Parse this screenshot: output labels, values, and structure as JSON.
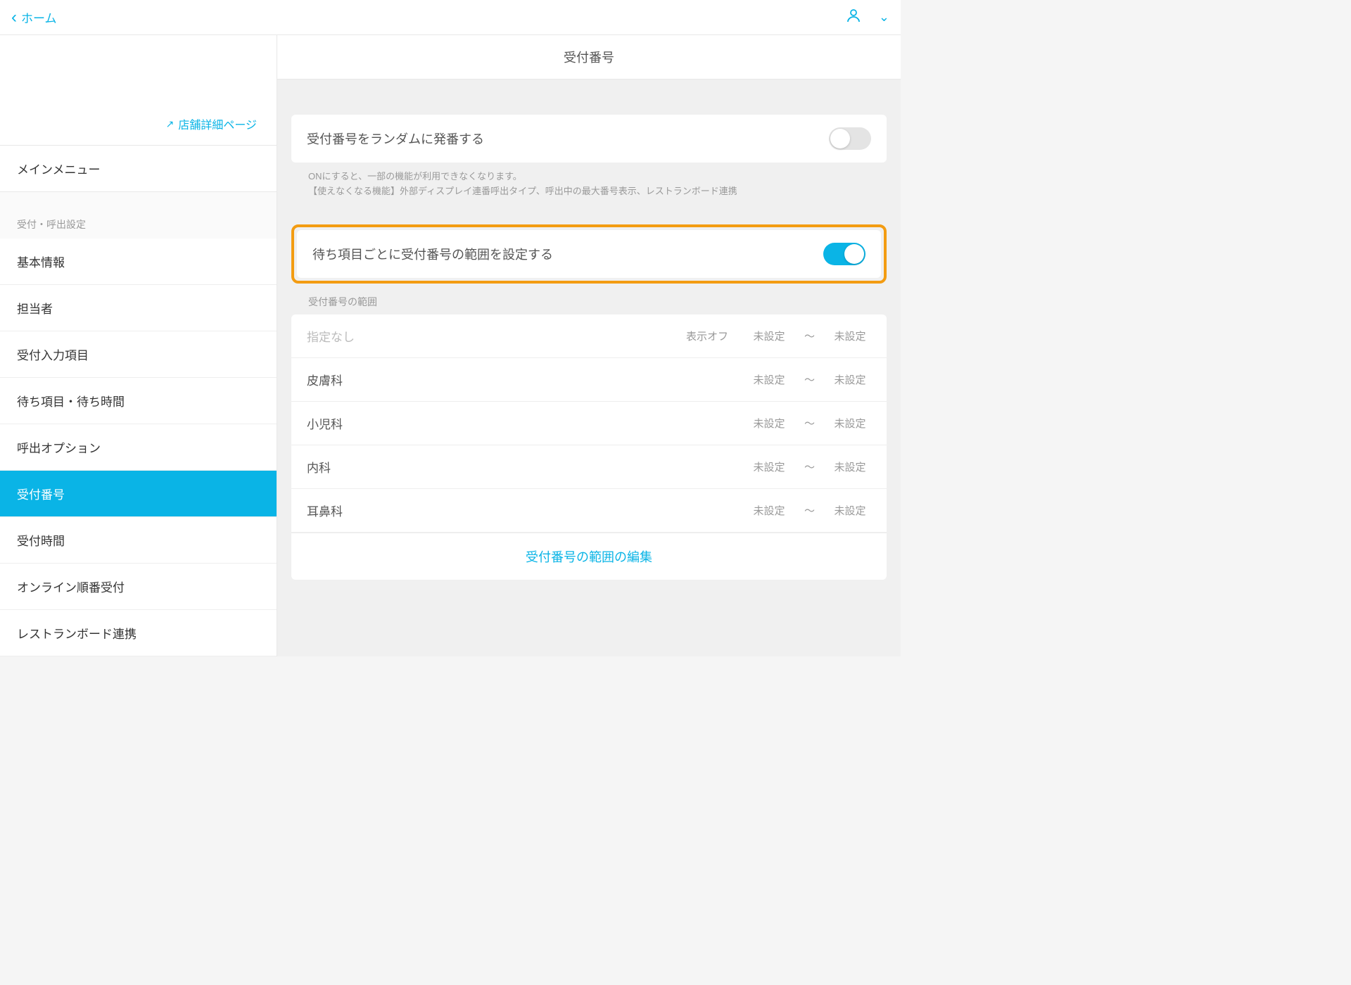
{
  "header": {
    "back_label": "ホーム"
  },
  "sidebar": {
    "store_link": "店舗詳細ページ",
    "main_menu": "メインメニュー",
    "section_label": "受付・呼出設定",
    "items": [
      {
        "label": "基本情報"
      },
      {
        "label": "担当者"
      },
      {
        "label": "受付入力項目"
      },
      {
        "label": "待ち項目・待ち時間"
      },
      {
        "label": "呼出オプション"
      },
      {
        "label": "受付番号"
      },
      {
        "label": "受付時間"
      },
      {
        "label": "オンライン順番受付"
      },
      {
        "label": "レストランボード連携"
      }
    ]
  },
  "content": {
    "title": "受付番号",
    "random_toggle_label": "受付番号をランダムに発番する",
    "help_line1": "ONにすると、一部の機能が利用できなくなります。",
    "help_line2": "【使えなくなる機能】外部ディスプレイ連番呼出タイプ、呼出中の最大番号表示、レストランボード連携",
    "range_toggle_label": "待ち項目ごとに受付番号の範囲を設定する",
    "range_section_label": "受付番号の範囲",
    "display_off": "表示オフ",
    "tilde": "〜",
    "unset": "未設定",
    "rows": [
      {
        "name": "指定なし",
        "muted": true,
        "display_off": true
      },
      {
        "name": "皮膚科"
      },
      {
        "name": "小児科"
      },
      {
        "name": "内科"
      },
      {
        "name": "耳鼻科"
      }
    ],
    "edit_link": "受付番号の範囲の編集"
  }
}
